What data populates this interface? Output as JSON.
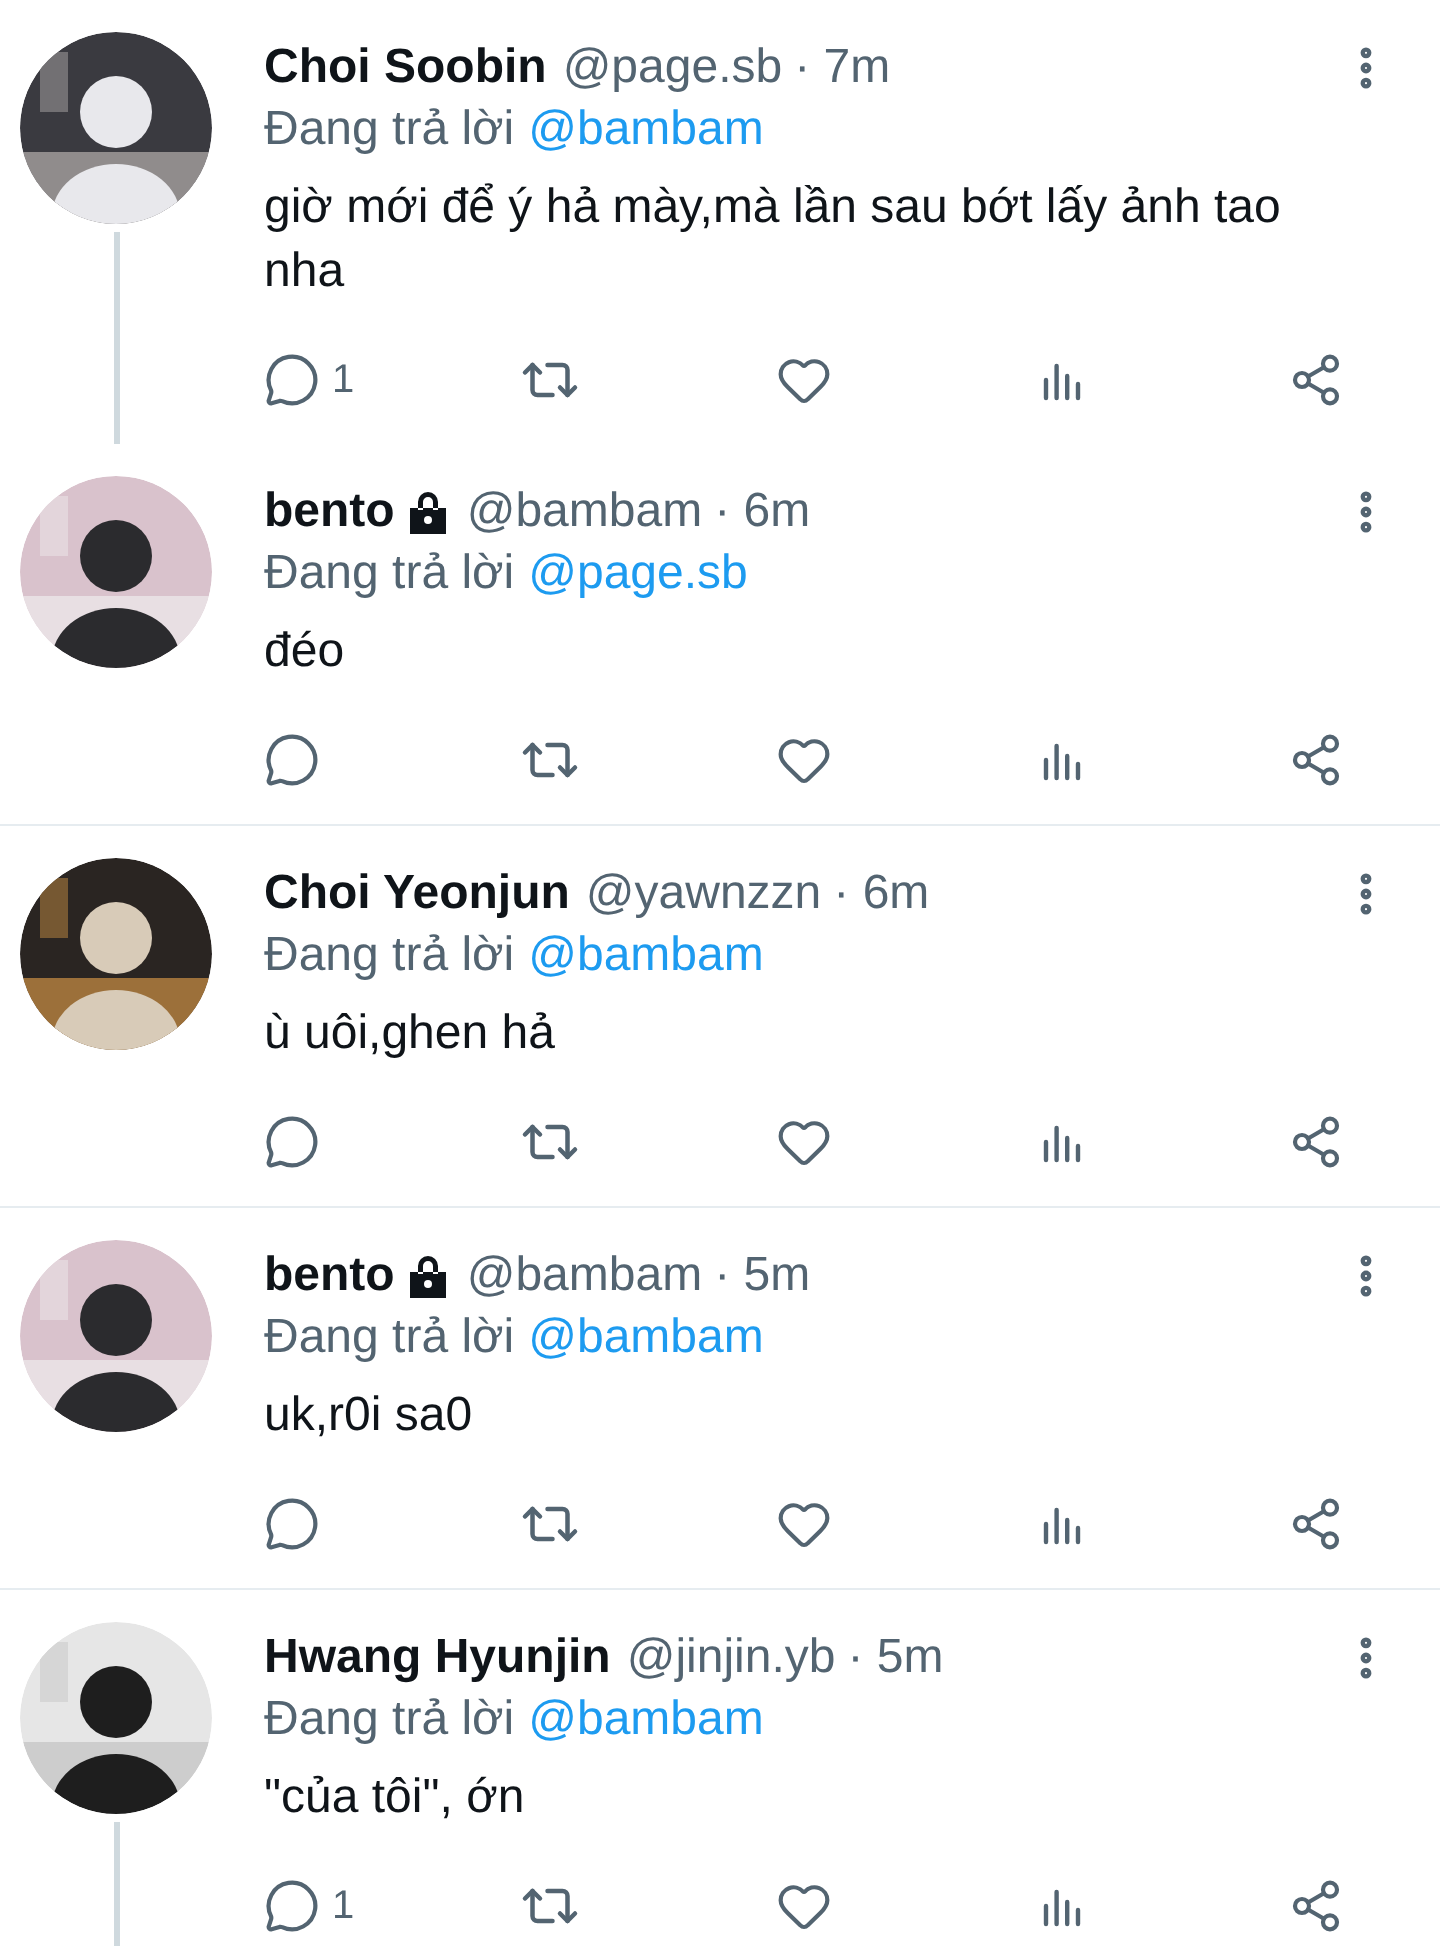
{
  "tweets": [
    {
      "name": "Choi Soobin",
      "locked": false,
      "handle": "@page.sb",
      "time": "· 7m",
      "reply_label": "Đang trả lời",
      "reply_to": "@bambam",
      "text": "giờ mới để ý hả mày,mà lần sau bớt lấy ảnh tao nha",
      "reply_count": "1",
      "thread_below": true
    },
    {
      "name": "bento",
      "locked": true,
      "handle": "@bambam",
      "time": "· 6m",
      "reply_label": "Đang trả lời",
      "reply_to": "@page.sb",
      "text": "đéo",
      "thread_below": false
    },
    {
      "name": "Choi Yeonjun",
      "locked": false,
      "handle": "@yawnzzn",
      "time": "· 6m",
      "reply_label": "Đang trả lời",
      "reply_to": "@bambam",
      "text": "ù uôi,ghen hả",
      "thread_below": false
    },
    {
      "name": "bento",
      "locked": true,
      "handle": "@bambam",
      "time": "· 5m",
      "reply_label": "Đang trả lời",
      "reply_to": "@bambam",
      "text": "uk,r0i sa0",
      "thread_below": false
    },
    {
      "name": "Hwang Hyunjin",
      "locked": false,
      "handle": "@jinjin.yb",
      "time": "· 5m",
      "reply_label": "Đang trả lời",
      "reply_to": "@bambam",
      "text": "\"của tôi\", ớn",
      "reply_count": "1",
      "thread_below": true
    }
  ]
}
